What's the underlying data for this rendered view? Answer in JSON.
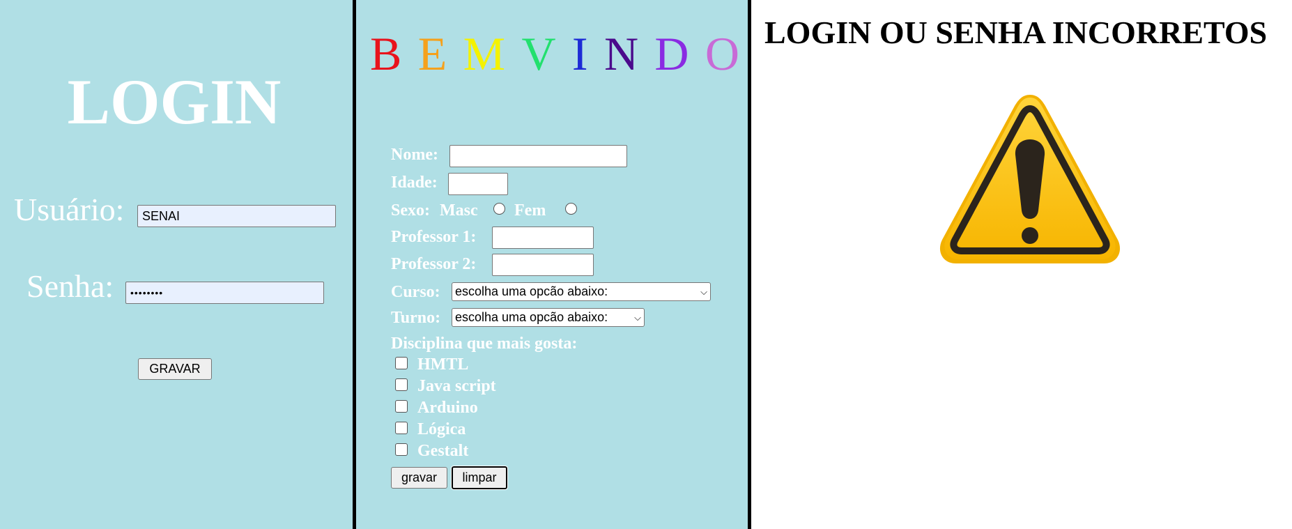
{
  "login": {
    "title": "LOGIN",
    "usuario_label": "Usuário:",
    "usuario_value": "SENAI",
    "senha_label": "Senha:",
    "senha_value": "••••••••",
    "gravar_label": "GRAVAR"
  },
  "form": {
    "welcome_letters": [
      {
        "char": "B",
        "color": "#e8131c"
      },
      {
        "char": "E",
        "color": "#f5a11c"
      },
      {
        "char": "M",
        "color": "#f4f200"
      },
      {
        "char": "V",
        "color": "#22e06e"
      },
      {
        "char": "I",
        "color": "#1d2bd6"
      },
      {
        "char": "N",
        "color": "#4b0a8c"
      },
      {
        "char": "D",
        "color": "#8a2be2"
      },
      {
        "char": "O",
        "color": "#c86ad6"
      }
    ],
    "nome_label": "Nome:",
    "idade_label": "Idade:",
    "sexo_label": "Sexo:",
    "masc_label": "Masc",
    "fem_label": "Fem",
    "professor1_label": "Professor 1:",
    "professor2_label": "Professor 2:",
    "curso_label": "Curso:",
    "curso_selected": "escolha uma opcão abaixo:",
    "turno_label": "Turno:",
    "turno_selected": "escolha uma opcão abaixo:",
    "disciplina_label": "Disciplina que mais gosta:",
    "disciplinas": [
      "HMTL",
      "Java script",
      "Arduino",
      "Lógica",
      "Gestalt"
    ],
    "gravar_label": "gravar",
    "limpar_label": "limpar"
  },
  "error": {
    "title": "LOGIN OU SENHA INCORRETOS"
  },
  "icons": {
    "warning": "warning-icon",
    "dropdown": "chevron-down-icon"
  },
  "colors": {
    "panel_bg": "#b0dfe5",
    "warning_yellow": "#fbc317",
    "warning_dark": "#2b241c"
  }
}
